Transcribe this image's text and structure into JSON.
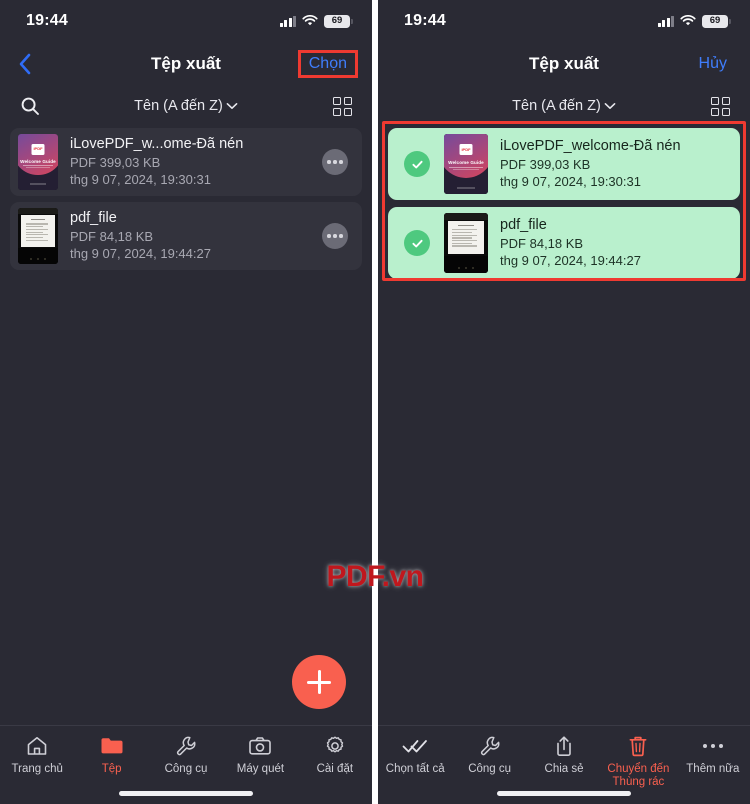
{
  "colors": {
    "background": "#2a2a34",
    "row": "#33333d",
    "selected_row": "#b9f0cd",
    "accent_red": "#f9604f",
    "link_blue": "#3f7dfb",
    "highlight_box": "#ef3a31",
    "check_green": "#4ec97f"
  },
  "left": {
    "status": {
      "time": "19:44",
      "battery": "69",
      "cell_icon": "cellular-bars-icon",
      "wifi_icon": "wifi-icon",
      "battery_icon": "battery-icon"
    },
    "nav": {
      "back_icon": "chevron-left-icon",
      "title": "Tệp xuất",
      "action_label": "Chọn"
    },
    "toolbar": {
      "search_icon": "search-icon",
      "sort_label": "Tên (A đến Z)",
      "chevron_icon": "chevron-down-icon",
      "grid_icon": "grid-view-icon"
    },
    "files": [
      {
        "name": "iLovePDF_w...ome-Đã nén",
        "size": "PDF 399,03 KB",
        "date": "thg 9 07, 2024, 19:30:31",
        "thumb": "ilovepdf-welcome-guide-thumbnail",
        "badge": "iPDF",
        "thumb_title": "Welcome Guide",
        "more_icon": "more-options-icon"
      },
      {
        "name": "pdf_file",
        "size": "PDF 84,18 KB",
        "date": "thg 9 07, 2024, 19:44:27",
        "thumb": "document-scan-thumbnail",
        "more_icon": "more-options-icon"
      }
    ],
    "fab": {
      "icon": "plus-icon"
    },
    "tabs": [
      {
        "label": "Trang chủ",
        "icon": "home-icon",
        "active": false
      },
      {
        "label": "Tệp",
        "icon": "folder-icon",
        "active": true
      },
      {
        "label": "Công cụ",
        "icon": "wrench-icon",
        "active": false
      },
      {
        "label": "Máy quét",
        "icon": "camera-icon",
        "active": false
      },
      {
        "label": "Cài đặt",
        "icon": "gear-icon",
        "active": false
      }
    ]
  },
  "right": {
    "status": {
      "time": "19:44",
      "battery": "69",
      "cell_icon": "cellular-bars-icon",
      "wifi_icon": "wifi-icon",
      "battery_icon": "battery-icon"
    },
    "nav": {
      "title": "Tệp xuất",
      "action_label": "Hủy"
    },
    "toolbar": {
      "sort_label": "Tên (A đến Z)",
      "chevron_icon": "chevron-down-icon",
      "grid_icon": "grid-view-icon"
    },
    "files": [
      {
        "name": "iLovePDF_welcome-Đã nén",
        "size": "PDF 399,03 KB",
        "date": "thg 9 07, 2024, 19:30:31",
        "thumb": "ilovepdf-welcome-guide-thumbnail",
        "badge": "iPDF",
        "thumb_title": "Welcome Guide",
        "selected": true,
        "check_icon": "check-circle-icon"
      },
      {
        "name": "pdf_file",
        "size": "PDF 84,18 KB",
        "date": "thg 9 07, 2024, 19:44:27",
        "thumb": "document-scan-thumbnail",
        "selected": true,
        "check_icon": "check-circle-icon"
      }
    ],
    "tabs": [
      {
        "label": "Chọn tất cả",
        "icon": "double-check-icon",
        "danger": false
      },
      {
        "label": "Công cụ",
        "icon": "wrench-icon",
        "danger": false
      },
      {
        "label": "Chia sẻ",
        "icon": "share-icon",
        "danger": false
      },
      {
        "label": "Chuyển đến\nThùng rác",
        "label_line1": "Chuyển đến",
        "label_line2": "Thùng rác",
        "icon": "trash-icon",
        "danger": true
      },
      {
        "label": "Thêm nữa",
        "icon": "more-horizontal-icon",
        "danger": false
      }
    ]
  },
  "watermark": {
    "text": "PDF.vn"
  }
}
